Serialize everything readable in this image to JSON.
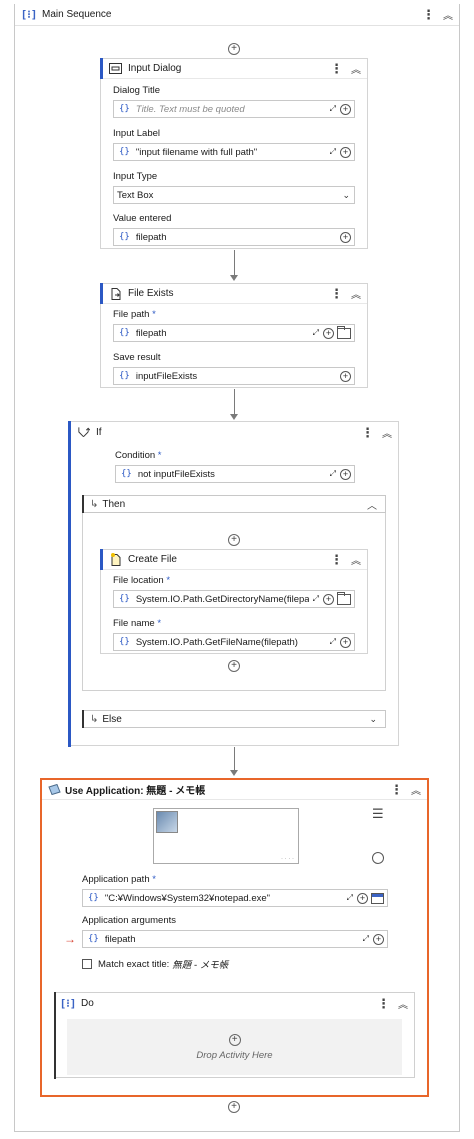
{
  "main_sequence": {
    "title": "Main Sequence"
  },
  "input_dialog": {
    "title": "Input Dialog",
    "dialog_title_label": "Dialog Title",
    "dialog_title_placeholder": "Title. Text must be quoted",
    "input_label_label": "Input Label",
    "input_label_value": "\"input filename with full path\"",
    "input_type_label": "Input Type",
    "input_type_value": "Text Box",
    "value_entered_label": "Value entered",
    "value_entered_value": "filepath"
  },
  "file_exists": {
    "title": "File Exists",
    "file_path_label": "File path",
    "file_path_value": "filepath",
    "save_result_label": "Save result",
    "save_result_value": "inputFileExists"
  },
  "if_block": {
    "title": "If",
    "condition_label": "Condition",
    "condition_value": "not inputFileExists",
    "then_label": "Then",
    "else_label": "Else"
  },
  "create_file": {
    "title": "Create File",
    "file_location_label": "File location",
    "file_location_value": "System.IO.Path.GetDirectoryName(filepath)",
    "file_name_label": "File name",
    "file_name_value": "System.IO.Path.GetFileName(filepath)"
  },
  "use_application": {
    "title": "Use Application: 無題 - メモ帳",
    "app_path_label": "Application path",
    "app_path_value": "\"C:¥Windows¥System32¥notepad.exe\"",
    "app_args_label": "Application arguments",
    "app_args_value": "filepath",
    "match_title_label": "Match exact title:",
    "match_title_value": "無題 - メモ帳",
    "do_label": "Do",
    "drop_text": "Drop Activity Here"
  },
  "required_mark": "*",
  "braces": "{}",
  "colors": {
    "accent": "#2b58c4",
    "highlight_border": "#e8662a",
    "arrow_red": "#d63a2a"
  }
}
